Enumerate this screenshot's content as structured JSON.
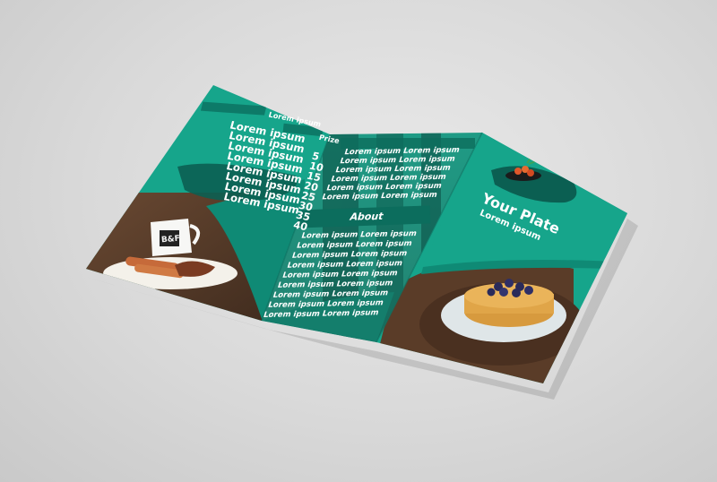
{
  "left_panel": {
    "column_header": "Lorem ipsum",
    "price_header": "Prize",
    "items": [
      {
        "name": "Lorem ipsum",
        "price": "5"
      },
      {
        "name": "Lorem ipsum",
        "price": "10"
      },
      {
        "name": "Lorem ipsum",
        "price": "15"
      },
      {
        "name": "Lorem ipsum",
        "price": "20"
      },
      {
        "name": "Lorem ipsum",
        "price": "25"
      },
      {
        "name": "Lorem ipsum",
        "price": "30"
      },
      {
        "name": "Lorem ipsum",
        "price": "35"
      },
      {
        "name": "Lorem ipsum",
        "price": "40"
      }
    ],
    "mug_text": "B&F"
  },
  "middle_panel": {
    "top_lines": [
      "Lorem ipsum  Lorem ipsum",
      "Lorem ipsum  Lorem ipsum",
      "Lorem ipsum  Lorem ipsum",
      "Lorem ipsum  Lorem ipsum",
      "Lorem ipsum  Lorem ipsum",
      "Lorem ipsum  Lorem ipsum"
    ],
    "about_heading": "About",
    "bottom_lines": [
      "Lorem ipsum  Lorem ipsum",
      "Lorem ipsum  Lorem ipsum",
      "Lorem ipsum  Lorem ipsum",
      "Lorem ipsum  Lorem ipsum",
      "Lorem ipsum  Lorem ipsum",
      "Lorem ipsum  Lorem ipsum",
      "Lorem ipsum  Lorem ipsum",
      "Lorem ipsum  Lorem ipsum",
      "Lorem ipsum  Lorem ipsum"
    ]
  },
  "right_panel": {
    "title": "Your Plate",
    "subtitle": "Lorem ipsum"
  },
  "colors": {
    "background": "#d9d9d9",
    "brochure_teal": "#15a38a",
    "dark_teal": "#0d7a68",
    "text": "#ffffff"
  }
}
